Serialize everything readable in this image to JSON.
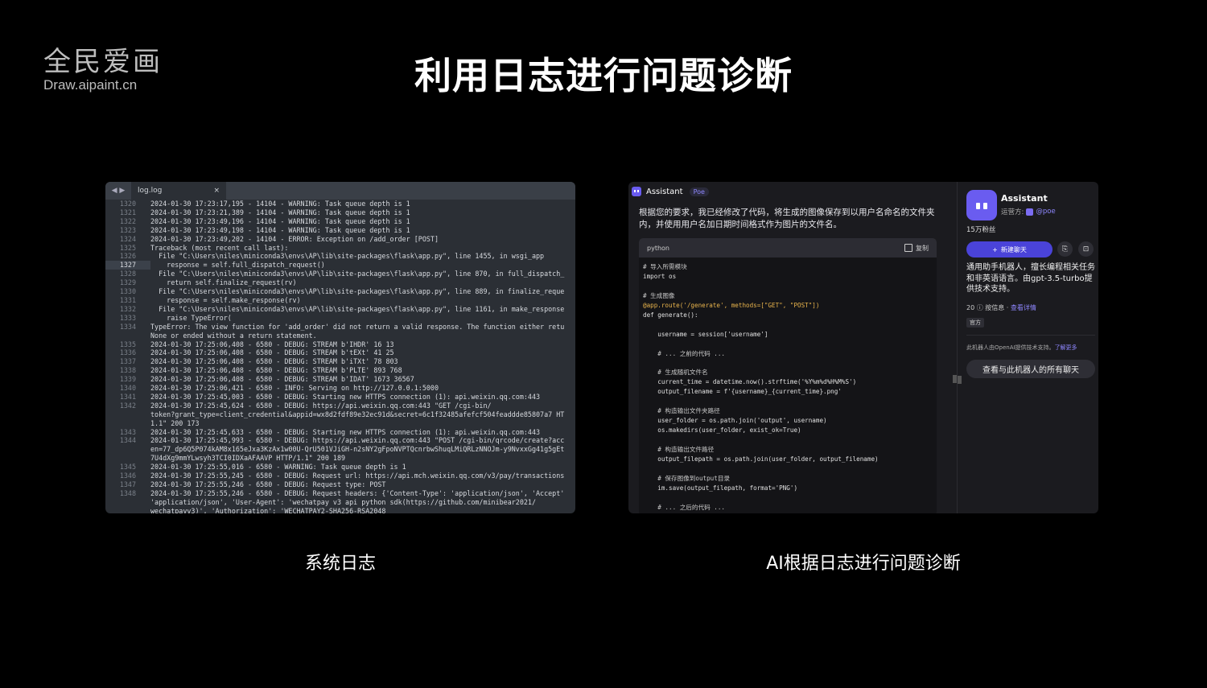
{
  "brand": {
    "name_cn": "全民爱画",
    "url": "Draw.aipaint.cn"
  },
  "title": "利用日志进行问题诊断",
  "editor": {
    "tab_label": "log.log",
    "close_glyph": "×",
    "nav_glyph": "◀ ▶",
    "lines": [
      {
        "n": "1320",
        "t": "2024-01-30 17:23:17,195 - 14104 - WARNING: Task queue depth is 1"
      },
      {
        "n": "1321",
        "t": "2024-01-30 17:23:21,389 - 14104 - WARNING: Task queue depth is 1"
      },
      {
        "n": "1322",
        "t": "2024-01-30 17:23:49,196 - 14104 - WARNING: Task queue depth is 1"
      },
      {
        "n": "1323",
        "t": "2024-01-30 17:23:49,198 - 14104 - WARNING: Task queue depth is 1"
      },
      {
        "n": "1324",
        "t": "2024-01-30 17:23:49,202 - 14104 - ERROR: Exception on /add_order [POST]"
      },
      {
        "n": "1325",
        "t": "Traceback (most recent call last):"
      },
      {
        "n": "1326",
        "t": "  File \"C:\\Users\\niles\\miniconda3\\envs\\AP\\lib\\site-packages\\flask\\app.py\", line 1455, in wsgi_app"
      },
      {
        "n": "1327",
        "t": "    response = self.full_dispatch_request()"
      },
      {
        "n": "1328",
        "t": "  File \"C:\\Users\\niles\\miniconda3\\envs\\AP\\lib\\site-packages\\flask\\app.py\", line 870, in full_dispatch_"
      },
      {
        "n": "1329",
        "t": "    return self.finalize_request(rv)"
      },
      {
        "n": "1330",
        "t": "  File \"C:\\Users\\niles\\miniconda3\\envs\\AP\\lib\\site-packages\\flask\\app.py\", line 889, in finalize_reque"
      },
      {
        "n": "1331",
        "t": "    response = self.make_response(rv)"
      },
      {
        "n": "1332",
        "t": "  File \"C:\\Users\\niles\\miniconda3\\envs\\AP\\lib\\site-packages\\flask\\app.py\", line 1161, in make_response"
      },
      {
        "n": "1333",
        "t": "    raise TypeError("
      },
      {
        "n": "1334",
        "t": "TypeError: The view function for 'add_order' did not return a valid response. The function either retu"
      },
      {
        "n": "",
        "t": "None or ended without a return statement."
      },
      {
        "n": "1335",
        "t": "2024-01-30 17:25:06,408 - 6580 - DEBUG: STREAM b'IHDR' 16 13"
      },
      {
        "n": "1336",
        "t": "2024-01-30 17:25:06,408 - 6580 - DEBUG: STREAM b'tEXt' 41 25"
      },
      {
        "n": "1337",
        "t": "2024-01-30 17:25:06,408 - 6580 - DEBUG: STREAM b'iTXt' 78 803"
      },
      {
        "n": "1338",
        "t": "2024-01-30 17:25:06,408 - 6580 - DEBUG: STREAM b'PLTE' 893 768"
      },
      {
        "n": "1339",
        "t": "2024-01-30 17:25:06,408 - 6580 - DEBUG: STREAM b'IDAT' 1673 36567"
      },
      {
        "n": "1340",
        "t": "2024-01-30 17:25:06,421 - 6580 - INFO: Serving on http://127.0.0.1:5000"
      },
      {
        "n": "1341",
        "t": "2024-01-30 17:25:45,003 - 6580 - DEBUG: Starting new HTTPS connection (1): api.weixin.qq.com:443"
      },
      {
        "n": "1342",
        "t": "2024-01-30 17:25:45,624 - 6580 - DEBUG: https://api.weixin.qq.com:443 \"GET /cgi-bin/"
      },
      {
        "n": "",
        "t": "token?grant_type=client_credential&appid=wx8d2fdf89e32ec91d&secret=6c1f32485afefcf504feaddde85807a7 HT"
      },
      {
        "n": "",
        "t": "1.1\" 200 173"
      },
      {
        "n": "1343",
        "t": "2024-01-30 17:25:45,633 - 6580 - DEBUG: Starting new HTTPS connection (1): api.weixin.qq.com:443"
      },
      {
        "n": "1344",
        "t": "2024-01-30 17:25:45,993 - 6580 - DEBUG: https://api.weixin.qq.com:443 \"POST /cgi-bin/qrcode/create?acc"
      },
      {
        "n": "",
        "t": "en=77_dp6Q5P074kAM8x165eJxa3KzAx1w00U-QrU501VJiGH-n2sNY2gFpoNVPTQcnrbwShuqLMiQRLzNNOJm-y9NvxxGg41g5gEt"
      },
      {
        "n": "",
        "t": "7U4dXg9mmYLwsyh3TCI0IDXaAFAAVP HTTP/1.1\" 200 189"
      },
      {
        "n": "1345",
        "t": "2024-01-30 17:25:55,016 - 6580 - WARNING: Task queue depth is 1"
      },
      {
        "n": "1346",
        "t": "2024-01-30 17:25:55,245 - 6580 - DEBUG: Request url: https://api.mch.weixin.qq.com/v3/pay/transactions"
      },
      {
        "n": "1347",
        "t": "2024-01-30 17:25:55,246 - 6580 - DEBUG: Request type: POST"
      },
      {
        "n": "1348",
        "t": "2024-01-30 17:25:55,246 - 6580 - DEBUG: Request headers: {'Content-Type': 'application/json', 'Accept'"
      },
      {
        "n": "",
        "t": "'application/json', 'User-Agent': 'wechatpay v3 api python sdk(https://github.com/minibear2021/"
      },
      {
        "n": "",
        "t": "wechatpayv3)', 'Authorization': 'WECHATPAY2-SHA256-RSA2048"
      }
    ],
    "current_line": "1327"
  },
  "chat": {
    "bot_name": "Assistant",
    "poe_tag": "Poe",
    "message": "根据您的要求，我已经修改了代码，将生成的图像保存到以用户名命名的文件夹内，并使用用户名加日期时间格式作为图片的文件名。",
    "code_lang": "python",
    "copy_label": "复制",
    "code": [
      {
        "c": "cm",
        "t": "# 导入所需模块"
      },
      {
        "c": "kw",
        "t": "import os"
      },
      {
        "c": "",
        "t": ""
      },
      {
        "c": "cm",
        "t": "# 生成图像"
      },
      {
        "c": "dec",
        "t": "@app.route('/generate', methods=[\"GET\", \"POST\"])"
      },
      {
        "c": "kw",
        "t": "def generate():"
      },
      {
        "c": "",
        "t": ""
      },
      {
        "c": "kw",
        "t": "    username = session['username']"
      },
      {
        "c": "",
        "t": ""
      },
      {
        "c": "cm",
        "t": "    # ... 之前的代码 ..."
      },
      {
        "c": "",
        "t": ""
      },
      {
        "c": "cm",
        "t": "    # 生成随机文件名"
      },
      {
        "c": "kw",
        "t": "    current_time = datetime.now().strftime('%Y%m%d%H%M%S')"
      },
      {
        "c": "kw",
        "t": "    output_filename = f'{username}_{current_time}.png'"
      },
      {
        "c": "",
        "t": ""
      },
      {
        "c": "cm",
        "t": "    # 构造输出文件夹路径"
      },
      {
        "c": "kw",
        "t": "    user_folder = os.path.join('output', username)"
      },
      {
        "c": "kw",
        "t": "    os.makedirs(user_folder, exist_ok=True)"
      },
      {
        "c": "",
        "t": ""
      },
      {
        "c": "cm",
        "t": "    # 构造输出文件路径"
      },
      {
        "c": "kw",
        "t": "    output_filepath = os.path.join(user_folder, output_filename)"
      },
      {
        "c": "",
        "t": ""
      },
      {
        "c": "cm",
        "t": "    # 保存图像到output目录"
      },
      {
        "c": "kw",
        "t": "    im.save(output_filepath, format='PNG')"
      },
      {
        "c": "",
        "t": ""
      },
      {
        "c": "cm",
        "t": "    # ... 之后的代码 ..."
      }
    ],
    "side": {
      "name": "Assistant",
      "operator_label": "运营方:",
      "operator": "@poe",
      "fans": "15万粉丝",
      "new_chat": "新建聊天",
      "plus_glyph": "+",
      "description": "通用助手机器人，擅长编程相关任务和非英语语言。由gpt-3.5-turbo提供技术支持。",
      "meta_prefix": "20 ⓘ 按信息 · ",
      "meta_link": "查看详情",
      "badge": "官方",
      "note_prefix": "此机器人由OpenAI提供技术支持。",
      "note_link": "了解更多",
      "view_all": "查看与此机器人的所有聊天"
    }
  },
  "captions": {
    "left": "系统日志",
    "right": "AI根据日志进行问题诊断"
  },
  "colors": {
    "accent": "#4a43d9",
    "bot": "#6a5cf0",
    "editor_bg": "#2b2f35",
    "chat_bg": "#1b1b1f"
  }
}
